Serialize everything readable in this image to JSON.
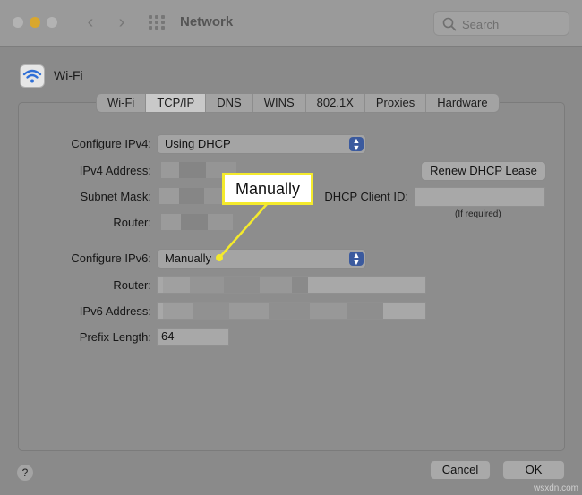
{
  "window": {
    "title": "Network",
    "search_placeholder": "Search"
  },
  "service": {
    "name": "Wi-Fi"
  },
  "tabs": [
    {
      "label": "Wi-Fi",
      "active": false
    },
    {
      "label": "TCP/IP",
      "active": true
    },
    {
      "label": "DNS",
      "active": false
    },
    {
      "label": "WINS",
      "active": false
    },
    {
      "label": "802.1X",
      "active": false
    },
    {
      "label": "Proxies",
      "active": false
    },
    {
      "label": "Hardware",
      "active": false
    }
  ],
  "ipv4": {
    "configure_label": "Configure IPv4:",
    "configure_value": "Using DHCP",
    "address_label": "IPv4 Address:",
    "subnet_label": "Subnet Mask:",
    "router_label": "Router:",
    "renew_button": "Renew DHCP Lease",
    "client_id_label": "DHCP Client ID:",
    "client_id_value": "",
    "client_id_note": "(If required)"
  },
  "ipv6": {
    "configure_label": "Configure IPv6:",
    "configure_value": "Manually",
    "router_label": "Router:",
    "address_label": "IPv6 Address:",
    "prefix_label": "Prefix Length:",
    "prefix_value": "64"
  },
  "annotation": {
    "text": "Manually",
    "color": "#f4ea2c"
  },
  "footer": {
    "help": "?",
    "cancel": "Cancel",
    "ok": "OK"
  },
  "watermark": "wsxdn.com",
  "colors": {
    "accent": "#3b5a9e",
    "minimize_light": "#d9a72e"
  }
}
